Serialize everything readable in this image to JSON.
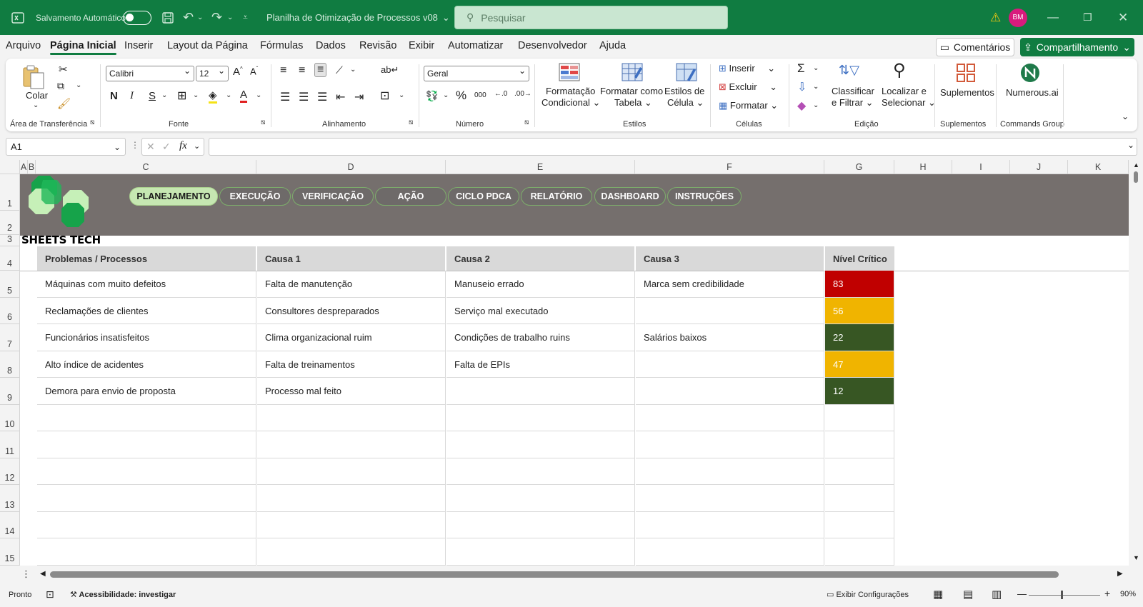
{
  "titlebar": {
    "autosave_label": "Salvamento Automático",
    "document_title": "Planilha de Otimização de Processos v08",
    "search_placeholder": "Pesquisar",
    "avatar_initials": "BM",
    "accent": "#107c41"
  },
  "menu": {
    "items": [
      "Arquivo",
      "Página Inicial",
      "Inserir",
      "Layout da Página",
      "Fórmulas",
      "Dados",
      "Revisão",
      "Exibir",
      "Automatizar",
      "Desenvolvedor",
      "Ajuda"
    ],
    "active": "Página Inicial",
    "comments_label": "Comentários",
    "share_label": "Compartilhamento"
  },
  "ribbon": {
    "paste_label": "Colar",
    "font_name": "Calibri",
    "font_size": "12",
    "number_format": "Geral",
    "conditional_format": [
      "Formatação",
      "Condicional"
    ],
    "format_table": [
      "Formatar como",
      "Tabela"
    ],
    "cell_styles": [
      "Estilos de",
      "Célula"
    ],
    "insert_label": "Inserir",
    "delete_label": "Excluir",
    "format_label": "Formatar",
    "sort_filter": [
      "Classificar",
      "e Filtrar"
    ],
    "find_select": [
      "Localizar e",
      "Selecionar"
    ],
    "addins_label": "Suplementos",
    "numerous_label": "Numerous.ai",
    "groups": {
      "clipboard": "Área de Transferência",
      "font": "Fonte",
      "alignment": "Alinhamento",
      "number": "Número",
      "styles": "Estilos",
      "cells": "Células",
      "editing": "Edição",
      "addins": "Suplementos",
      "commands": "Commands Group"
    }
  },
  "formula_bar": {
    "name_box": "A1",
    "fx_label": "fx",
    "formula": ""
  },
  "sheet": {
    "columns": [
      "A",
      "B",
      "C",
      "D",
      "E",
      "F",
      "G",
      "H",
      "I",
      "J",
      "K"
    ],
    "rows": [
      "1",
      "2",
      "3",
      "4",
      "5",
      "6",
      "7",
      "8",
      "9",
      "10",
      "11",
      "12",
      "13",
      "14",
      "15"
    ],
    "nav_buttons": [
      "PLANEJAMENTO",
      "EXECUÇÃO",
      "VERIFICAÇÃO",
      "AÇÃO",
      "CICLO PDCA",
      "RELATÓRIO",
      "DASHBOARD",
      "INSTRUÇÕES"
    ],
    "active_nav": "PLANEJAMENTO",
    "brand": "SHEETS TECH",
    "table_headers": [
      "Problemas / Processos",
      "Causa 1",
      "Causa 2",
      "Causa 3",
      "Nível Crítico"
    ],
    "table_rows": [
      [
        "Máquinas com muito defeitos",
        "Falta de manutenção",
        "Manuseio errado",
        "Marca sem credibilidade",
        "83"
      ],
      [
        "Reclamações de clientes",
        "Consultores despreparados",
        "Serviço mal executado",
        "",
        "56"
      ],
      [
        "Funcionários insatisfeitos",
        "Clima organizacional ruim",
        "Condições de trabalho ruins",
        "Salários baixos",
        "22"
      ],
      [
        "Alto índice de acidentes",
        "Falta de treinamentos",
        "Falta de EPIs",
        "",
        "47"
      ],
      [
        "Demora para envio de proposta",
        "Processo mal feito",
        "",
        "",
        "12"
      ]
    ],
    "level_colors": [
      "#c00000",
      "#f0b400",
      "#375623",
      "#f0b400",
      "#375623"
    ]
  },
  "statusbar": {
    "ready": "Pronto",
    "accessibility": "Acessibilidade: investigar",
    "display_settings": "Exibir Configurações",
    "zoom": "90%"
  }
}
